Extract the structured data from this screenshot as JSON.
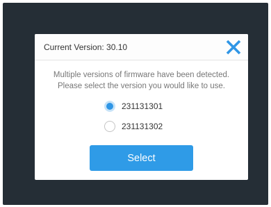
{
  "dialog": {
    "title": "Current Version: 30.10",
    "close_icon": "close-icon",
    "message_line1": "Multiple versions of firmware have been detected.",
    "message_line2": "Please select the version you would like to use.",
    "options": [
      {
        "label": "231131301",
        "selected": true
      },
      {
        "label": "231131302",
        "selected": false
      }
    ],
    "select_label": "Select"
  },
  "colors": {
    "backdrop": "#252e36",
    "accent": "#2f9be7"
  }
}
